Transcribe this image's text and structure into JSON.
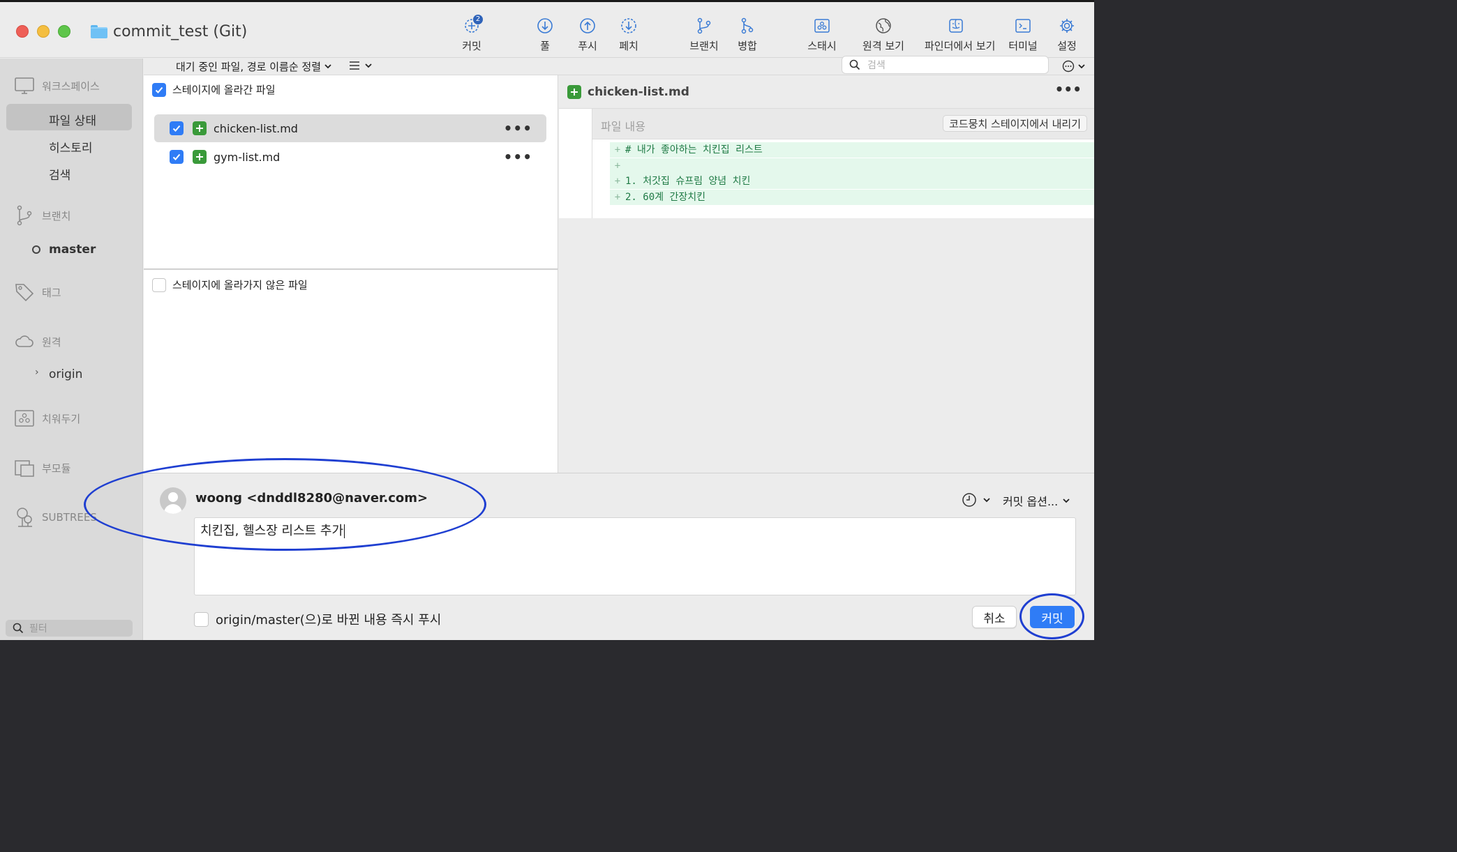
{
  "window": {
    "title": "commit_test (Git)"
  },
  "toolbar": {
    "commit": {
      "label": "커밋",
      "badge": "2"
    },
    "pull": {
      "label": "풀"
    },
    "push": {
      "label": "푸시"
    },
    "fetch": {
      "label": "페치"
    },
    "branch": {
      "label": "브랜치"
    },
    "merge": {
      "label": "병합"
    },
    "stash": {
      "label": "스태시"
    },
    "remote_view": {
      "label": "원격 보기"
    },
    "finder_view": {
      "label": "파인더에서 보기"
    },
    "terminal": {
      "label": "터미널"
    },
    "settings": {
      "label": "설정"
    }
  },
  "sidebar": {
    "workspace": {
      "label": "워크스페이스",
      "items": [
        "파일 상태",
        "히스토리",
        "검색"
      ],
      "selected": "파일 상태"
    },
    "branches": {
      "label": "브랜치",
      "items": [
        "master"
      ]
    },
    "tags": {
      "label": "태그"
    },
    "remotes": {
      "label": "원격",
      "items": [
        "origin"
      ]
    },
    "stashes": {
      "label": "치워두기"
    },
    "submodules": {
      "label": "부모듈"
    },
    "subtrees": {
      "label": "SUBTREES"
    },
    "filter_placeholder": "필터"
  },
  "sortbar": {
    "sort_label": "대기 중인 파일, 경로 이름순 정렬",
    "search_placeholder": "검색"
  },
  "staged": {
    "header": "스테이지에 올라간 파일",
    "checked": true,
    "files": [
      {
        "name": "chicken-list.md",
        "checked": true,
        "status": "added",
        "selected": true
      },
      {
        "name": "gym-list.md",
        "checked": true,
        "status": "added",
        "selected": false
      }
    ]
  },
  "unstaged": {
    "header": "스테이지에 올라가지 않은 파일",
    "checked": false
  },
  "diff": {
    "file": "chicken-list.md",
    "hunk_label": "파일 내용",
    "unstage_hunk_label": "코드뭉치 스테이지에서 내리기",
    "lines": [
      {
        "sign": "+",
        "text": "# 내가 좋아하는 치킨집 리스트"
      },
      {
        "sign": "+",
        "text": ""
      },
      {
        "sign": "+",
        "text": "1. 처갓집 슈프림 양념 치킨"
      },
      {
        "sign": "+",
        "text": "2. 60계 간장치킨"
      }
    ]
  },
  "commit": {
    "author": "woong <dnddl8280@naver.com>",
    "message": "치킨집, 헬스장 리스트 추가",
    "options_label": "커밋 옵션...",
    "push_option": "origin/master(으)로 바뀐 내용 즉시 푸시",
    "push_checked": false,
    "cancel_label": "취소",
    "commit_label": "커밋"
  },
  "colors": {
    "accent": "#2f7cf6",
    "added": "#3a9a3a",
    "annotation": "#1f3fd1"
  }
}
